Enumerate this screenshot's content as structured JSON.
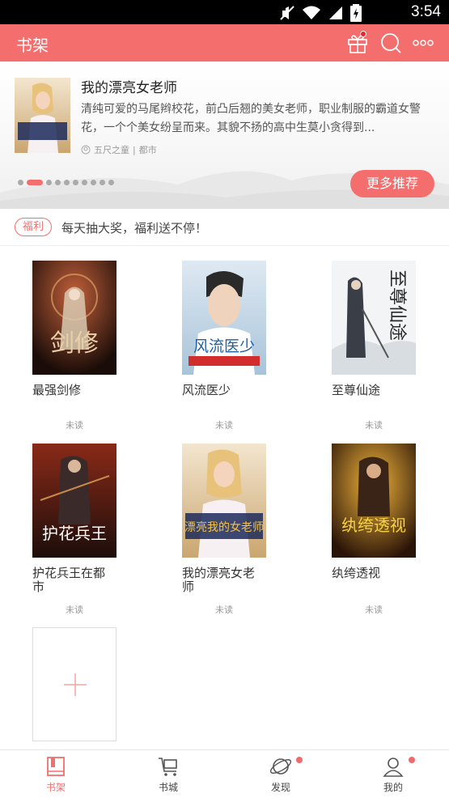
{
  "status_bar": {
    "time": "3:54",
    "icons": [
      "mute-icon",
      "wifi-icon",
      "signal-icon",
      "battery-icon"
    ]
  },
  "header": {
    "title": "书架",
    "icons": [
      "gift-icon",
      "search-icon",
      "more-icon"
    ]
  },
  "banner": {
    "title": "我的漂亮女老师",
    "description": "清纯可爱的马尾辫校花，前凸后翘的美女老师，职业制服的霸道女警花，一个个美女纷呈而来。其貌不扬的高中生莫小贪得到...",
    "author": "五尺之童",
    "separator": "|",
    "category": "都市",
    "more_button": "更多推荐",
    "cover_text": "漂亮我的女老师"
  },
  "notice": {
    "tag": "福利",
    "text": "每天抽大奖，福利送不停！"
  },
  "books": [
    {
      "title": "最强剑修",
      "status": "未读",
      "cover_text": "剑修"
    },
    {
      "title": "风流医少",
      "status": "未读",
      "cover_text": "风流医少"
    },
    {
      "title": "至尊仙途",
      "status": "未读",
      "cover_text": "至尊仙途"
    },
    {
      "title": "护花兵王在都市",
      "status": "未读",
      "cover_text": "护花兵王"
    },
    {
      "title": "我的漂亮女老师",
      "status": "未读",
      "cover_text": "漂亮我的女老师"
    },
    {
      "title": "纨绔透视",
      "status": "未读",
      "cover_text": "纨绔透视"
    }
  ],
  "tabs": [
    {
      "label": "书架",
      "active": true
    },
    {
      "label": "书城",
      "active": false
    },
    {
      "label": "发现",
      "active": false
    },
    {
      "label": "我的",
      "active": false
    }
  ],
  "colors": {
    "accent": "#f56e6e",
    "status_bar": "#000000"
  }
}
